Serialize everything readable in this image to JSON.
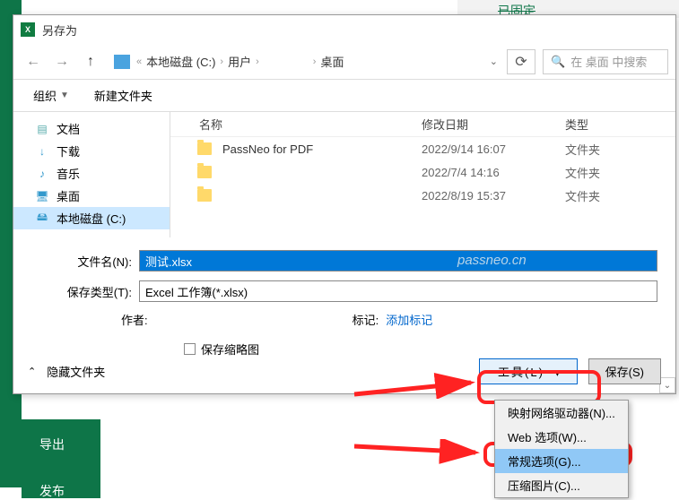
{
  "bg": {
    "pinned": "已固定"
  },
  "dialog": {
    "title": "另存为",
    "path": {
      "drive": "本地磁盘 (C:)",
      "users": "用户",
      "user_blur": " ",
      "desktop": "桌面"
    },
    "search_placeholder": "在 桌面 中搜索",
    "toolbar": {
      "organize": "组织",
      "newfolder": "新建文件夹"
    },
    "sidebar": {
      "documents": "文档",
      "downloads": "下载",
      "music": "音乐",
      "desktop": "桌面",
      "drive": "本地磁盘 (C:)"
    },
    "columns": {
      "name": "名称",
      "date": "修改日期",
      "type": "类型"
    },
    "rows": [
      {
        "name": "PassNeo for PDF",
        "date": "2022/9/14 16:07",
        "type": "文件夹"
      },
      {
        "name": " ",
        "date": "2022/7/4 14:16",
        "type": "文件夹"
      },
      {
        "name": " ",
        "date": "2022/8/19 15:37",
        "type": "文件夹"
      }
    ],
    "form": {
      "filename_label": "文件名(N):",
      "filename_value": "测试.xlsx",
      "filetype_label": "保存类型(T):",
      "filetype_value": "Excel 工作簿(*.xlsx)",
      "author_label": "作者:",
      "author_value": " ",
      "tags_label": "标记:",
      "tags_value": "添加标记",
      "thumbnail": "保存缩略图"
    },
    "footer": {
      "hide": "隐藏文件夹",
      "tools": "工具(L)",
      "save": "保存(S)"
    }
  },
  "dropdown": {
    "map_drive": "映射网络驱动器(N)...",
    "web_options": "Web 选项(W)...",
    "general_options": "常规选项(G)...",
    "compress_pics": "压缩图片(C)..."
  },
  "sidemenu": {
    "export": "导出",
    "publish": "发布"
  },
  "watermark": "passneo.cn"
}
